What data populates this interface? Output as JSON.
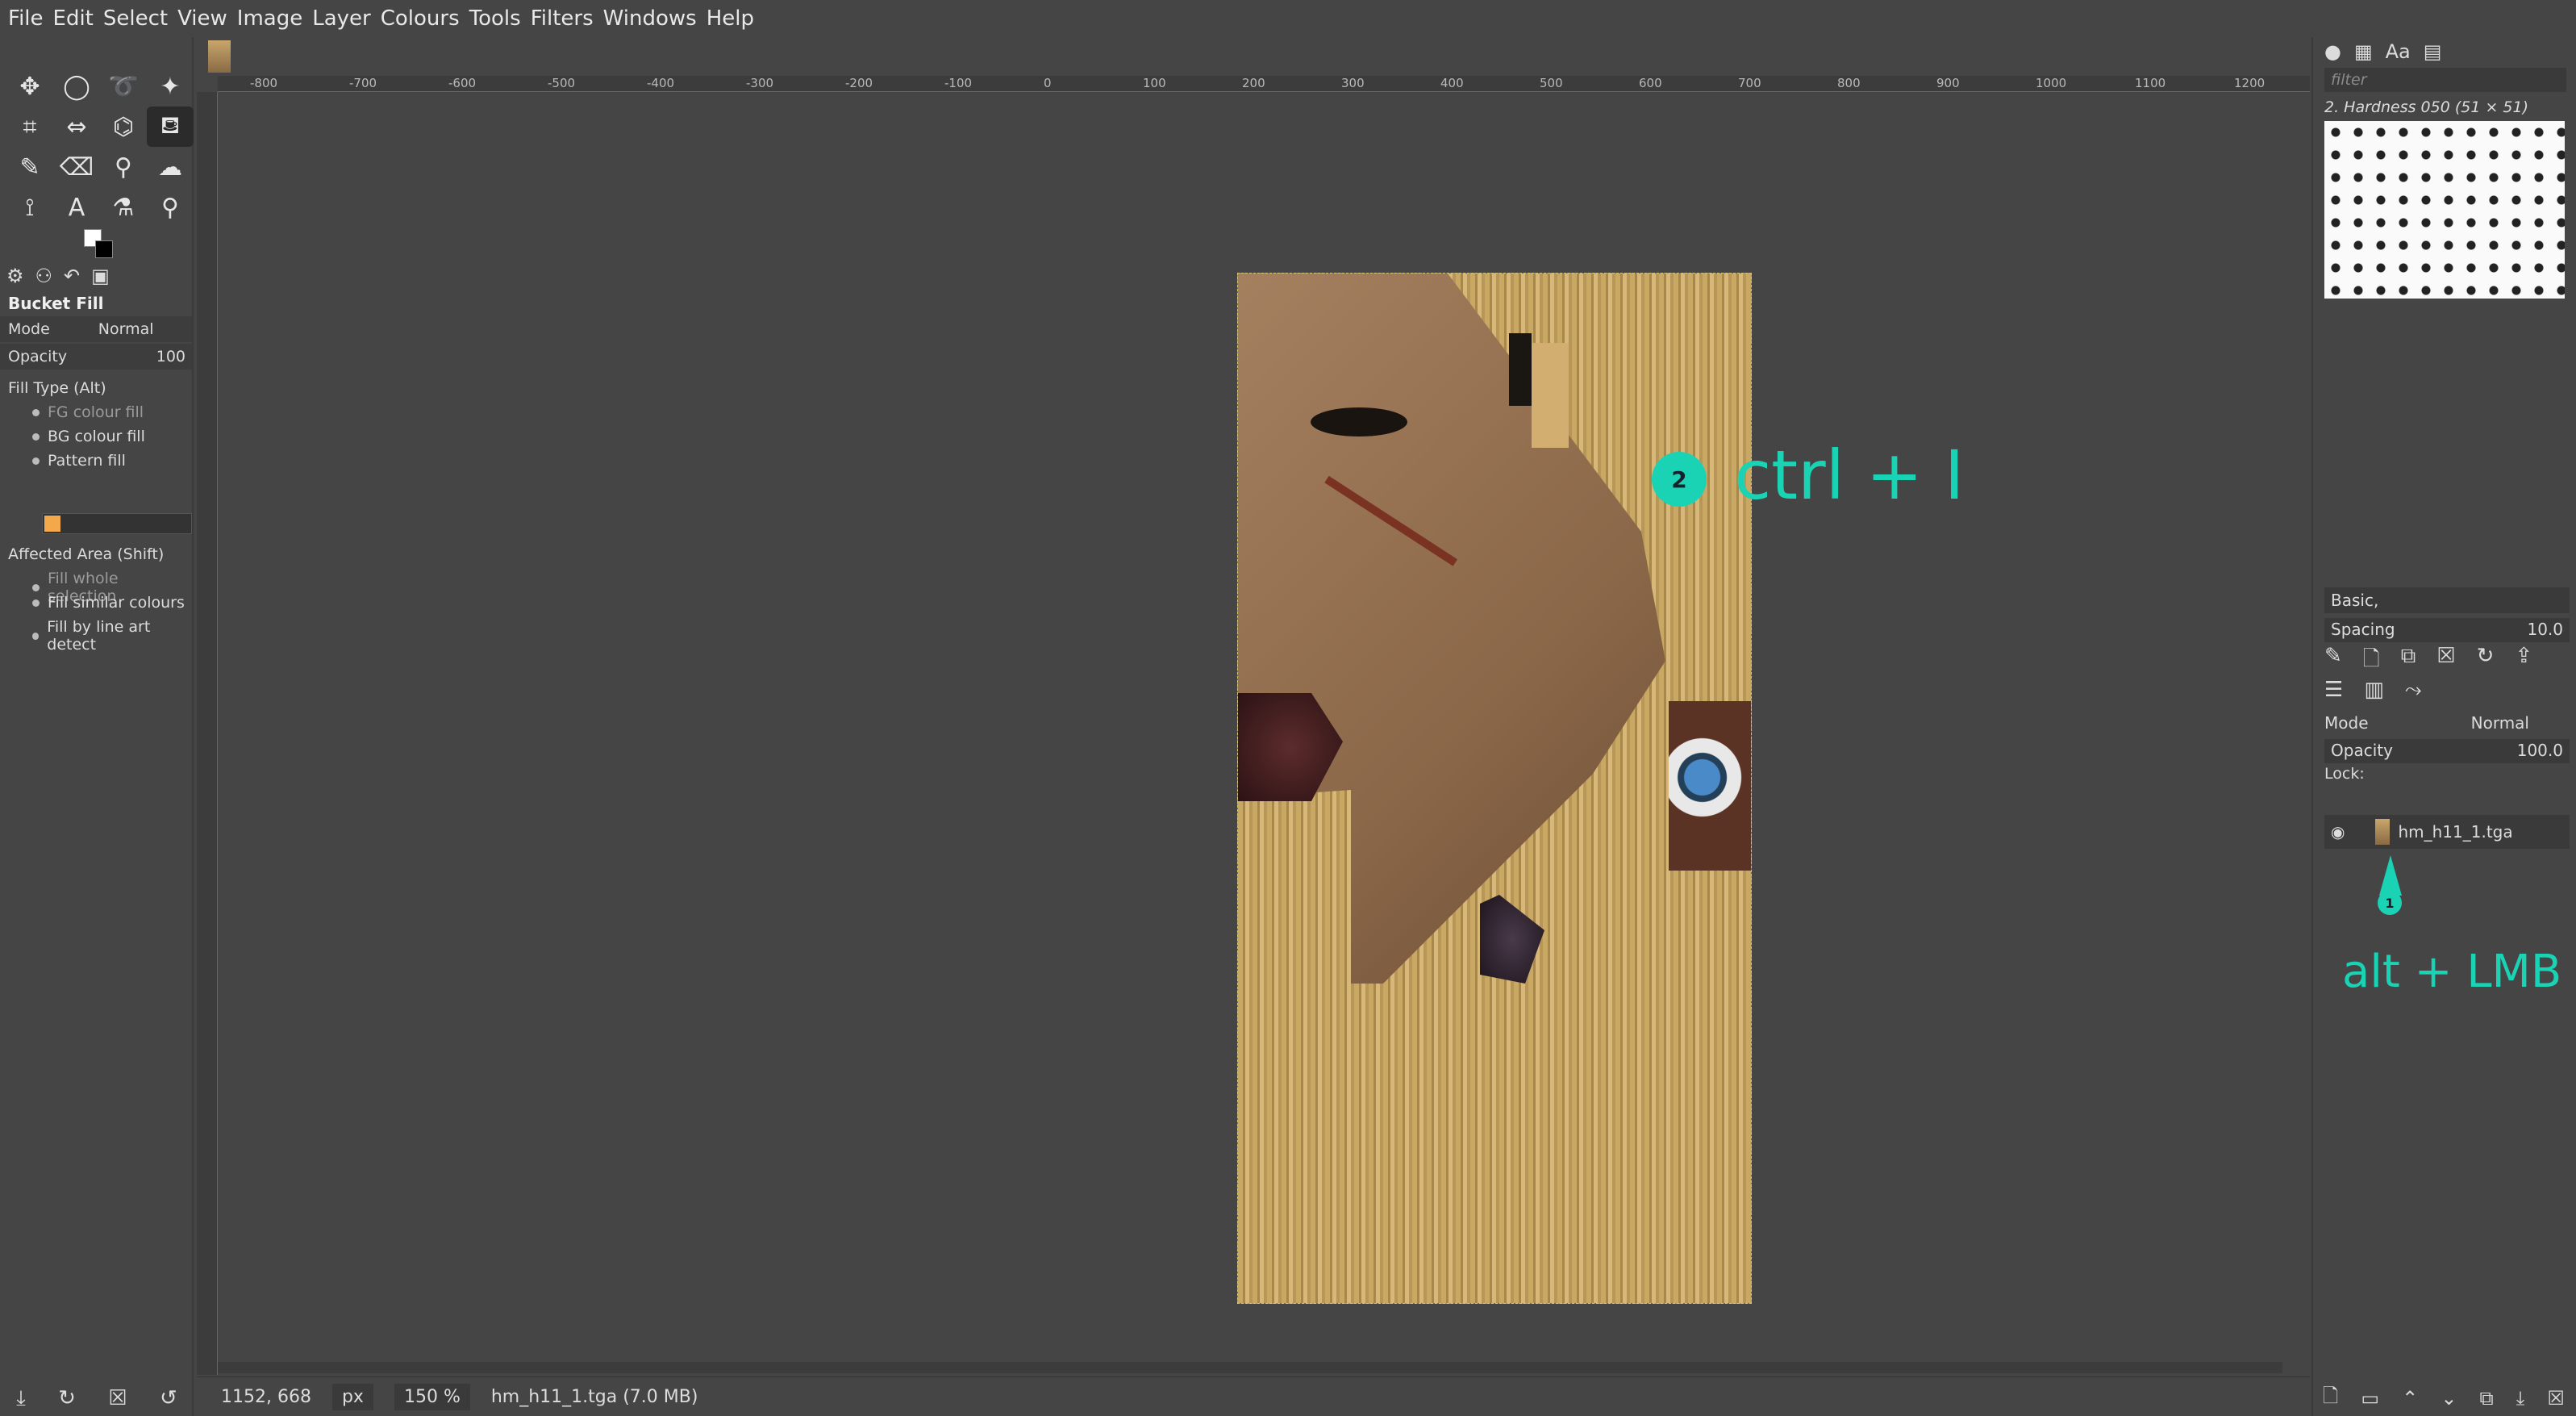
{
  "menu": [
    "File",
    "Edit",
    "Select",
    "View",
    "Image",
    "Layer",
    "Colours",
    "Tools",
    "Filters",
    "Windows",
    "Help"
  ],
  "tool_options": {
    "title": "Bucket Fill",
    "mode_label": "Mode",
    "mode_value": "Normal",
    "opacity_label": "Opacity",
    "opacity_value": "100",
    "fill_type_label": "Fill Type  (Alt)",
    "fill_types": [
      "FG colour fill",
      "BG colour fill",
      "Pattern fill"
    ],
    "affected_label": "Affected Area  (Shift)",
    "affected_options": [
      "Fill whole selection",
      "Fill similar colours",
      "Fill by line art detect"
    ]
  },
  "ruler_ticks": [
    "-800",
    "-700",
    "-600",
    "-500",
    "-400",
    "-300",
    "-200",
    "-100",
    "0",
    "100",
    "200",
    "300",
    "400",
    "500",
    "600",
    "700",
    "800",
    "900",
    "1000",
    "1100",
    "1200"
  ],
  "annotation_1": {
    "number": "2",
    "text": "ctrl + I"
  },
  "annotation_2": {
    "number": "1",
    "text": "alt + LMB"
  },
  "status": {
    "coords": "1152, 668",
    "unit": "px",
    "zoom": "150 %",
    "file": "hm_h11_1.tga (7.0 MB)"
  },
  "brushes": {
    "filter_placeholder": "filter",
    "current": "2. Hardness 050 (51 × 51)",
    "preset": "Basic,",
    "spacing_label": "Spacing",
    "spacing_value": "10.0"
  },
  "layers": {
    "mode_label": "Mode",
    "mode_value": "Normal",
    "opacity_label": "Opacity",
    "opacity_value": "100.0",
    "lock_label": "Lock:",
    "layer_name": "hm_h11_1.tga"
  },
  "accent_color": "#19d3b4"
}
